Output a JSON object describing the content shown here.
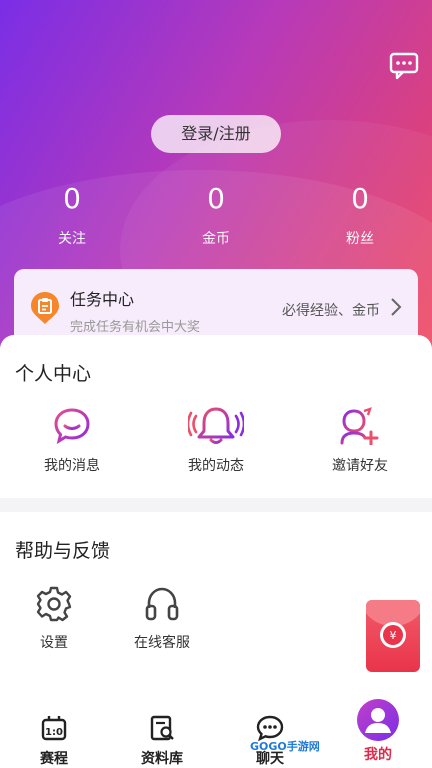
{
  "header": {
    "login_label": "登录/注册"
  },
  "stats": [
    {
      "value": "0",
      "label": "关注"
    },
    {
      "value": "0",
      "label": "金币"
    },
    {
      "value": "0",
      "label": "粉丝"
    }
  ],
  "task": {
    "title": "任务中心",
    "subtitle": "完成任务有机会中大奖",
    "reward": "必得经验、金币"
  },
  "personal": {
    "title": "个人中心",
    "items": [
      {
        "label": "我的消息",
        "icon": "chat-bubble-icon"
      },
      {
        "label": "我的动态",
        "icon": "bell-icon"
      },
      {
        "label": "邀请好友",
        "icon": "add-user-icon"
      }
    ]
  },
  "help": {
    "title": "帮助与反馈",
    "items": [
      {
        "label": "设置",
        "icon": "gear-icon"
      },
      {
        "label": "在线客服",
        "icon": "headset-icon"
      }
    ]
  },
  "tabs": [
    {
      "label": "赛程",
      "icon": "schedule-icon"
    },
    {
      "label": "资料库",
      "icon": "database-icon"
    },
    {
      "label": "聊天",
      "icon": "chat-icon"
    },
    {
      "label": "我的",
      "icon": "profile-icon",
      "active": true
    }
  ],
  "watermark": "GOGO手游网",
  "colors": {
    "accent": "#e0294c",
    "purple": "#9b30d9",
    "hero_start": "#7a2ee6",
    "hero_end": "#f0455a"
  }
}
